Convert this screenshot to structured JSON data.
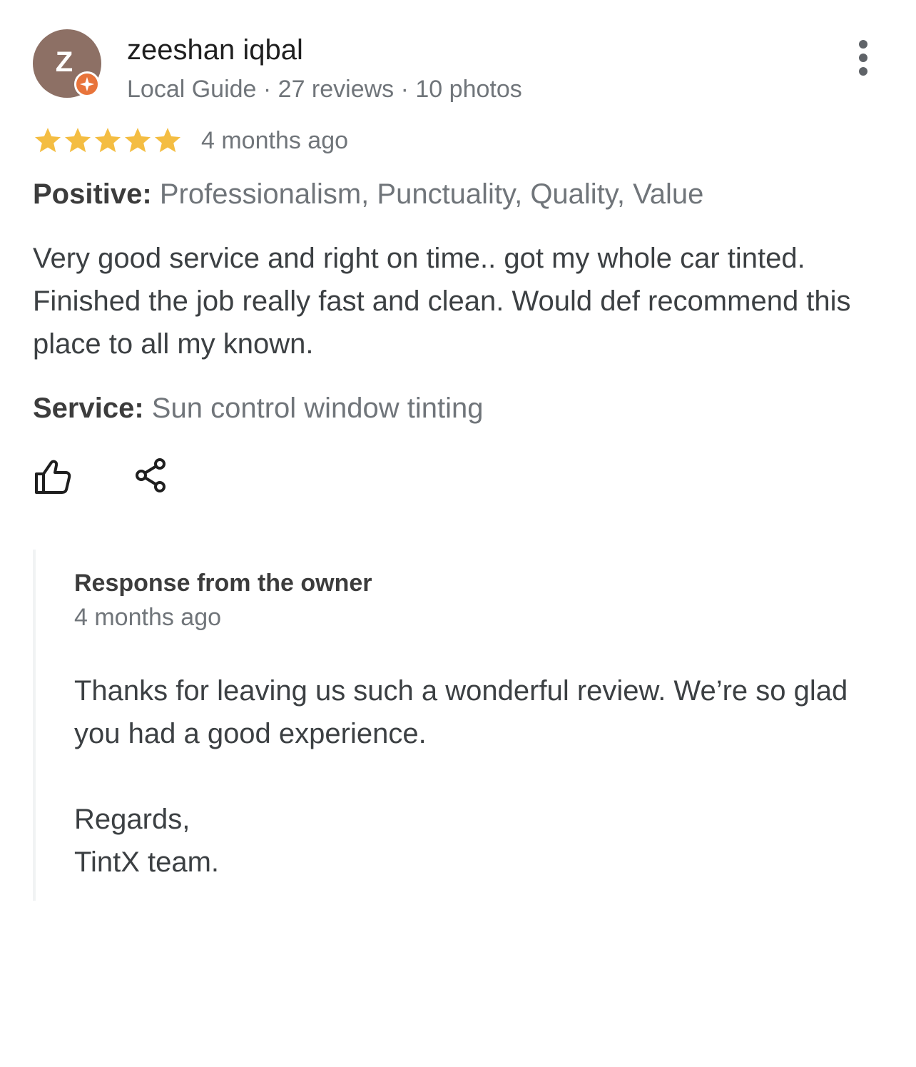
{
  "review": {
    "author": {
      "initial": "Z",
      "name": "zeeshan iqbal",
      "meta": "Local Guide · 27 reviews · 10 photos",
      "avatar_color": "#8d7065",
      "badge_color": "#e8743b"
    },
    "rating": 5,
    "rating_max": 5,
    "star_color": "#f4bd42",
    "time": "4 months ago",
    "positive": {
      "label": "Positive:",
      "value": "Professionalism, Punctuality, Quality, Value"
    },
    "text": "Very good service and right on time.. got my whole car tinted. Finished the job really fast and clean. Would def recommend this place to all my known.",
    "service": {
      "label": "Service:",
      "value": "Sun control window tinting"
    },
    "actions": {
      "like_icon": "thumb-up-icon",
      "share_icon": "share-icon",
      "more_icon": "more-vert-icon"
    }
  },
  "owner_response": {
    "title": "Response from the owner",
    "time": "4 months ago",
    "text": "Thanks for leaving us such a wonderful review. We’re so glad you had a good experience.",
    "sign_lines": [
      "Regards,",
      "TintX team."
    ]
  }
}
